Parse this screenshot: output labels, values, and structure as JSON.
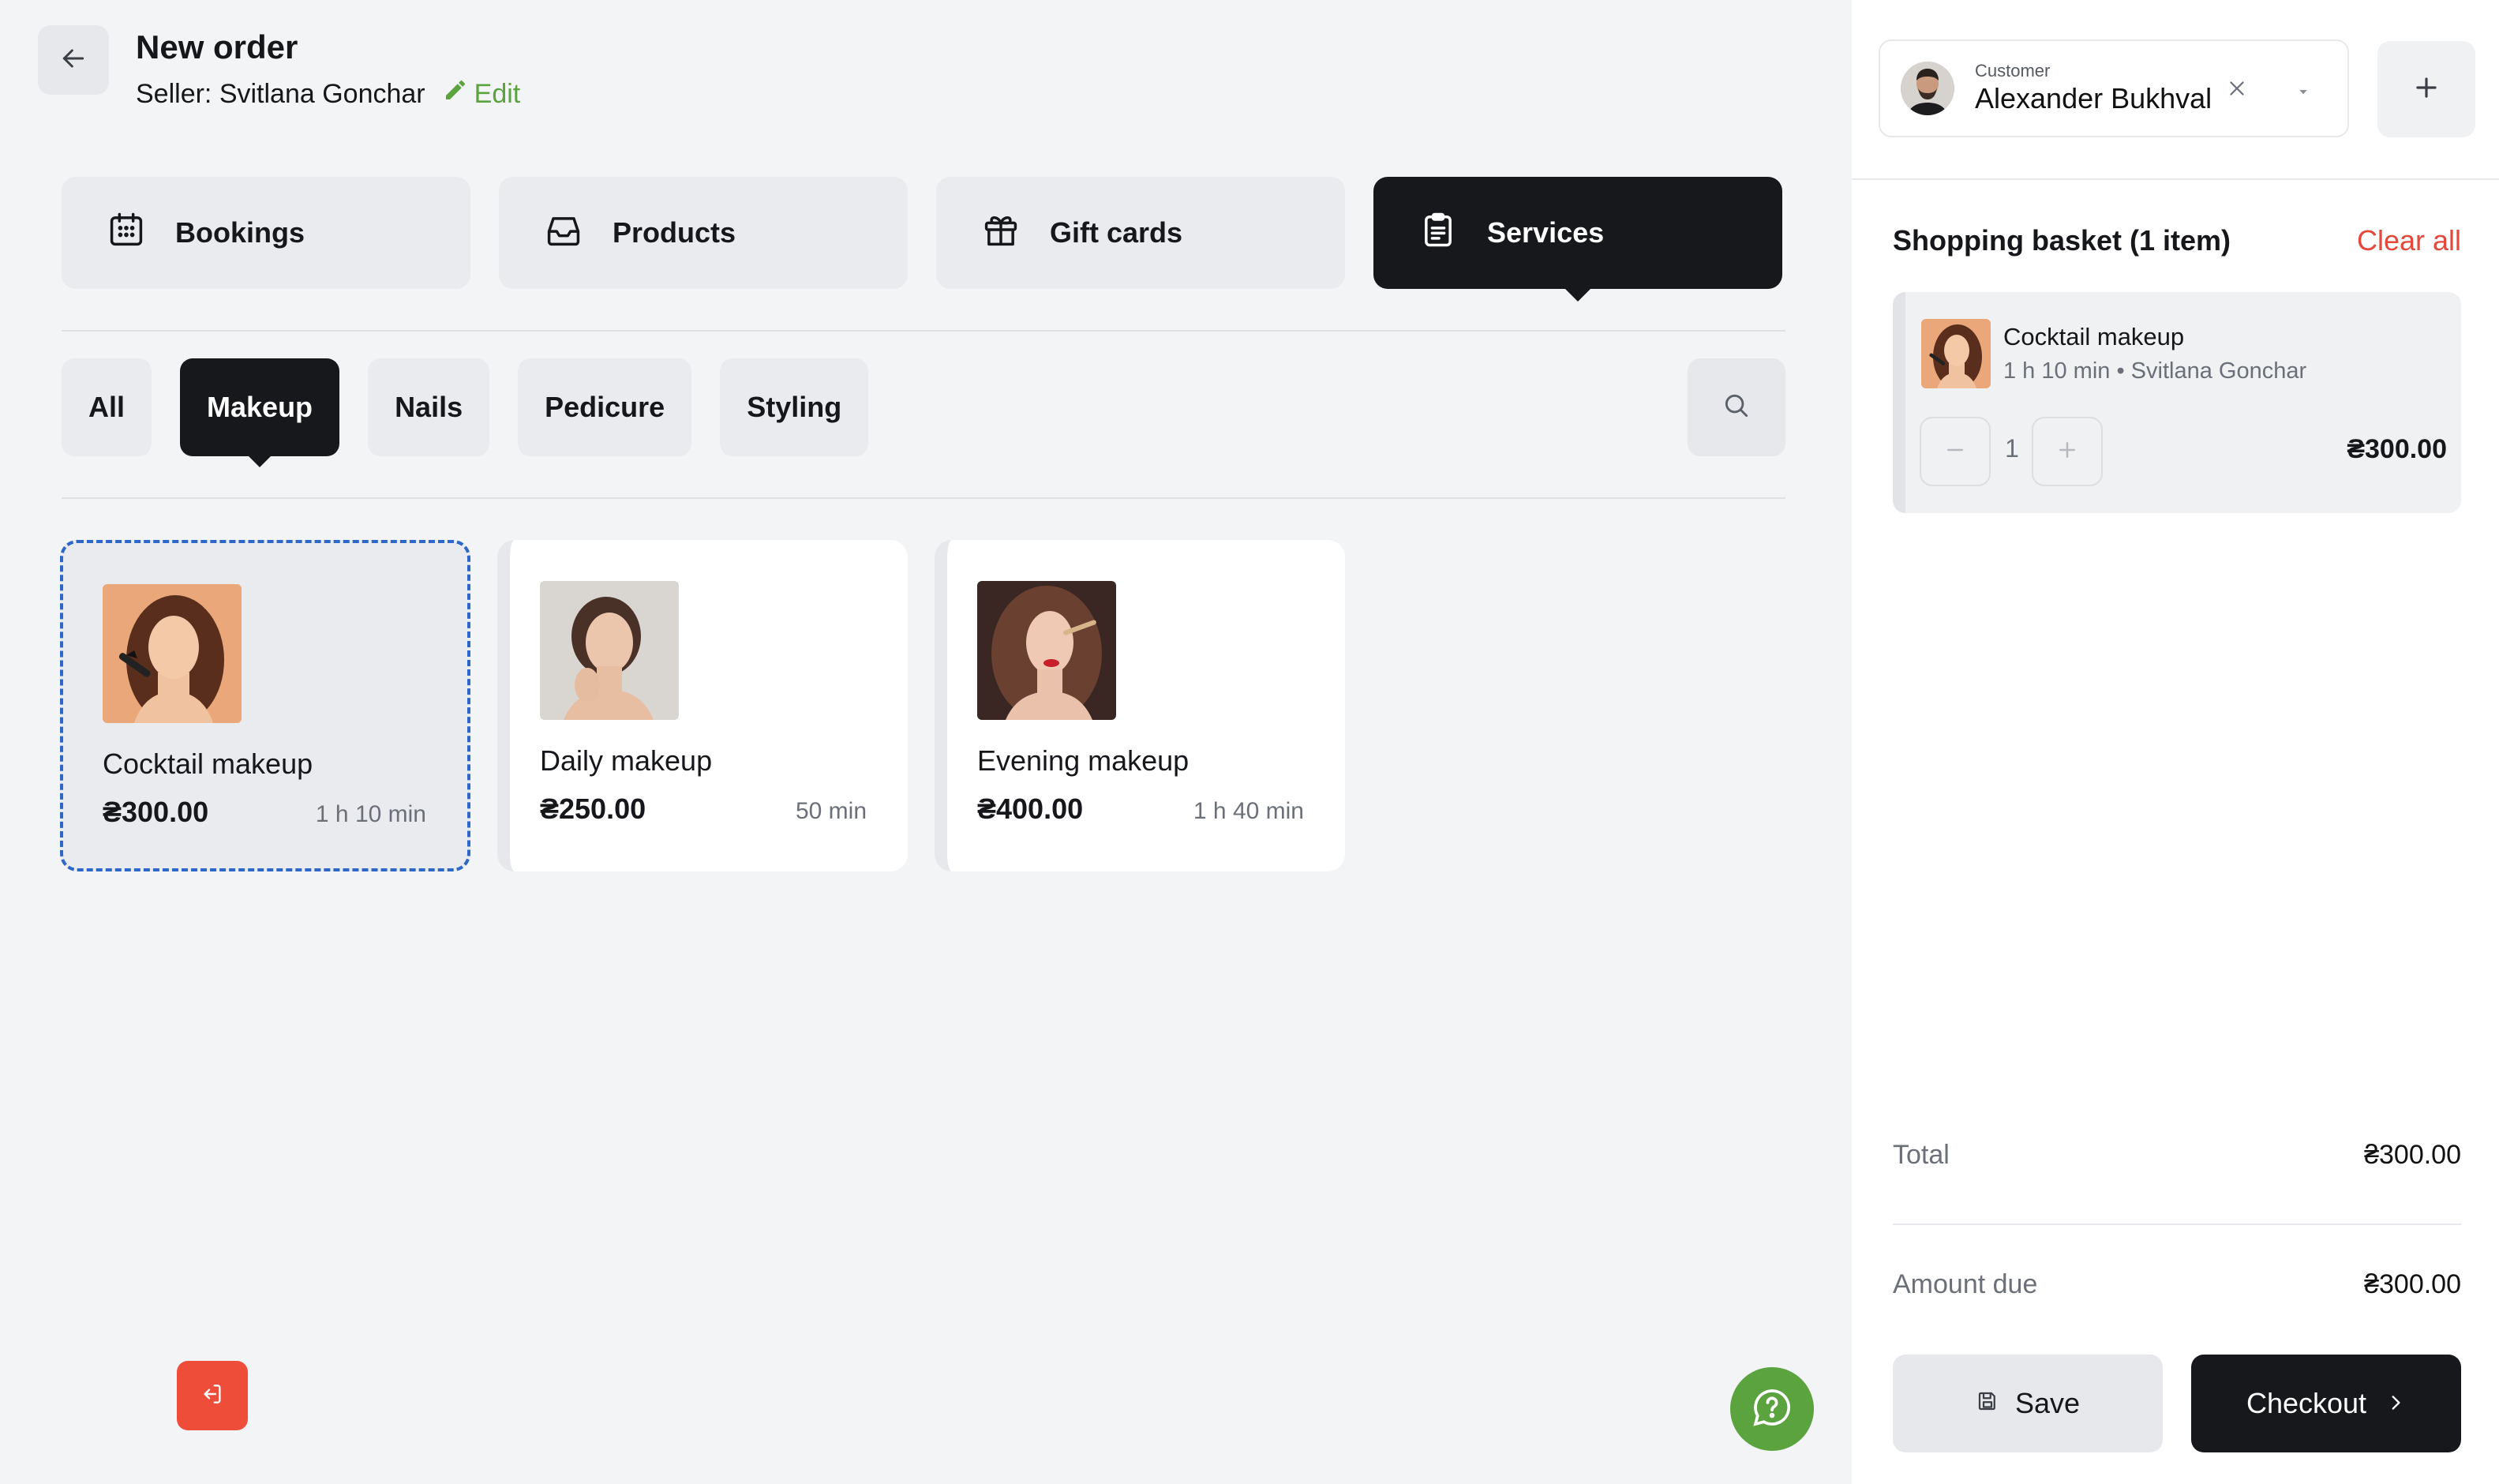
{
  "header": {
    "title": "New order",
    "seller_text": "Seller: Svitlana Gonchar",
    "edit_label": "Edit"
  },
  "categories": [
    {
      "label": "Bookings",
      "icon": "calendar-icon",
      "active": false
    },
    {
      "label": "Products",
      "icon": "inbox-icon",
      "active": false
    },
    {
      "label": "Gift cards",
      "icon": "gift-icon",
      "active": false
    },
    {
      "label": "Services",
      "icon": "clipboard-icon",
      "active": true
    }
  ],
  "subcategories": [
    {
      "label": "All",
      "active": false
    },
    {
      "label": "Makeup",
      "active": true
    },
    {
      "label": "Nails",
      "active": false
    },
    {
      "label": "Pedicure",
      "active": false
    },
    {
      "label": "Styling",
      "active": false
    }
  ],
  "services": [
    {
      "name": "Cocktail makeup",
      "price": "₴300.00",
      "duration": "1 h 10 min",
      "selected": true
    },
    {
      "name": "Daily makeup",
      "price": "₴250.00",
      "duration": "50 min",
      "selected": false
    },
    {
      "name": "Evening makeup",
      "price": "₴400.00",
      "duration": "1 h 40 min",
      "selected": false
    }
  ],
  "customer": {
    "label": "Customer",
    "name": "Alexander Bukhval"
  },
  "basket": {
    "title": "Shopping basket (1 item)",
    "clear_label": "Clear all",
    "items": [
      {
        "name": "Cocktail makeup",
        "meta": "1 h 10 min • Svitlana Gonchar",
        "quantity": "1",
        "price": "₴300.00"
      }
    ]
  },
  "totals": {
    "total_label": "Total",
    "total_value": "₴300.00",
    "due_label": "Amount due",
    "due_value": "₴300.00"
  },
  "actions": {
    "save_label": "Save",
    "checkout_label": "Checkout"
  },
  "colors": {
    "accent_dark": "#16181c",
    "selected_border": "#2d67c9",
    "danger": "#e3483a",
    "success": "#5aa33f"
  }
}
